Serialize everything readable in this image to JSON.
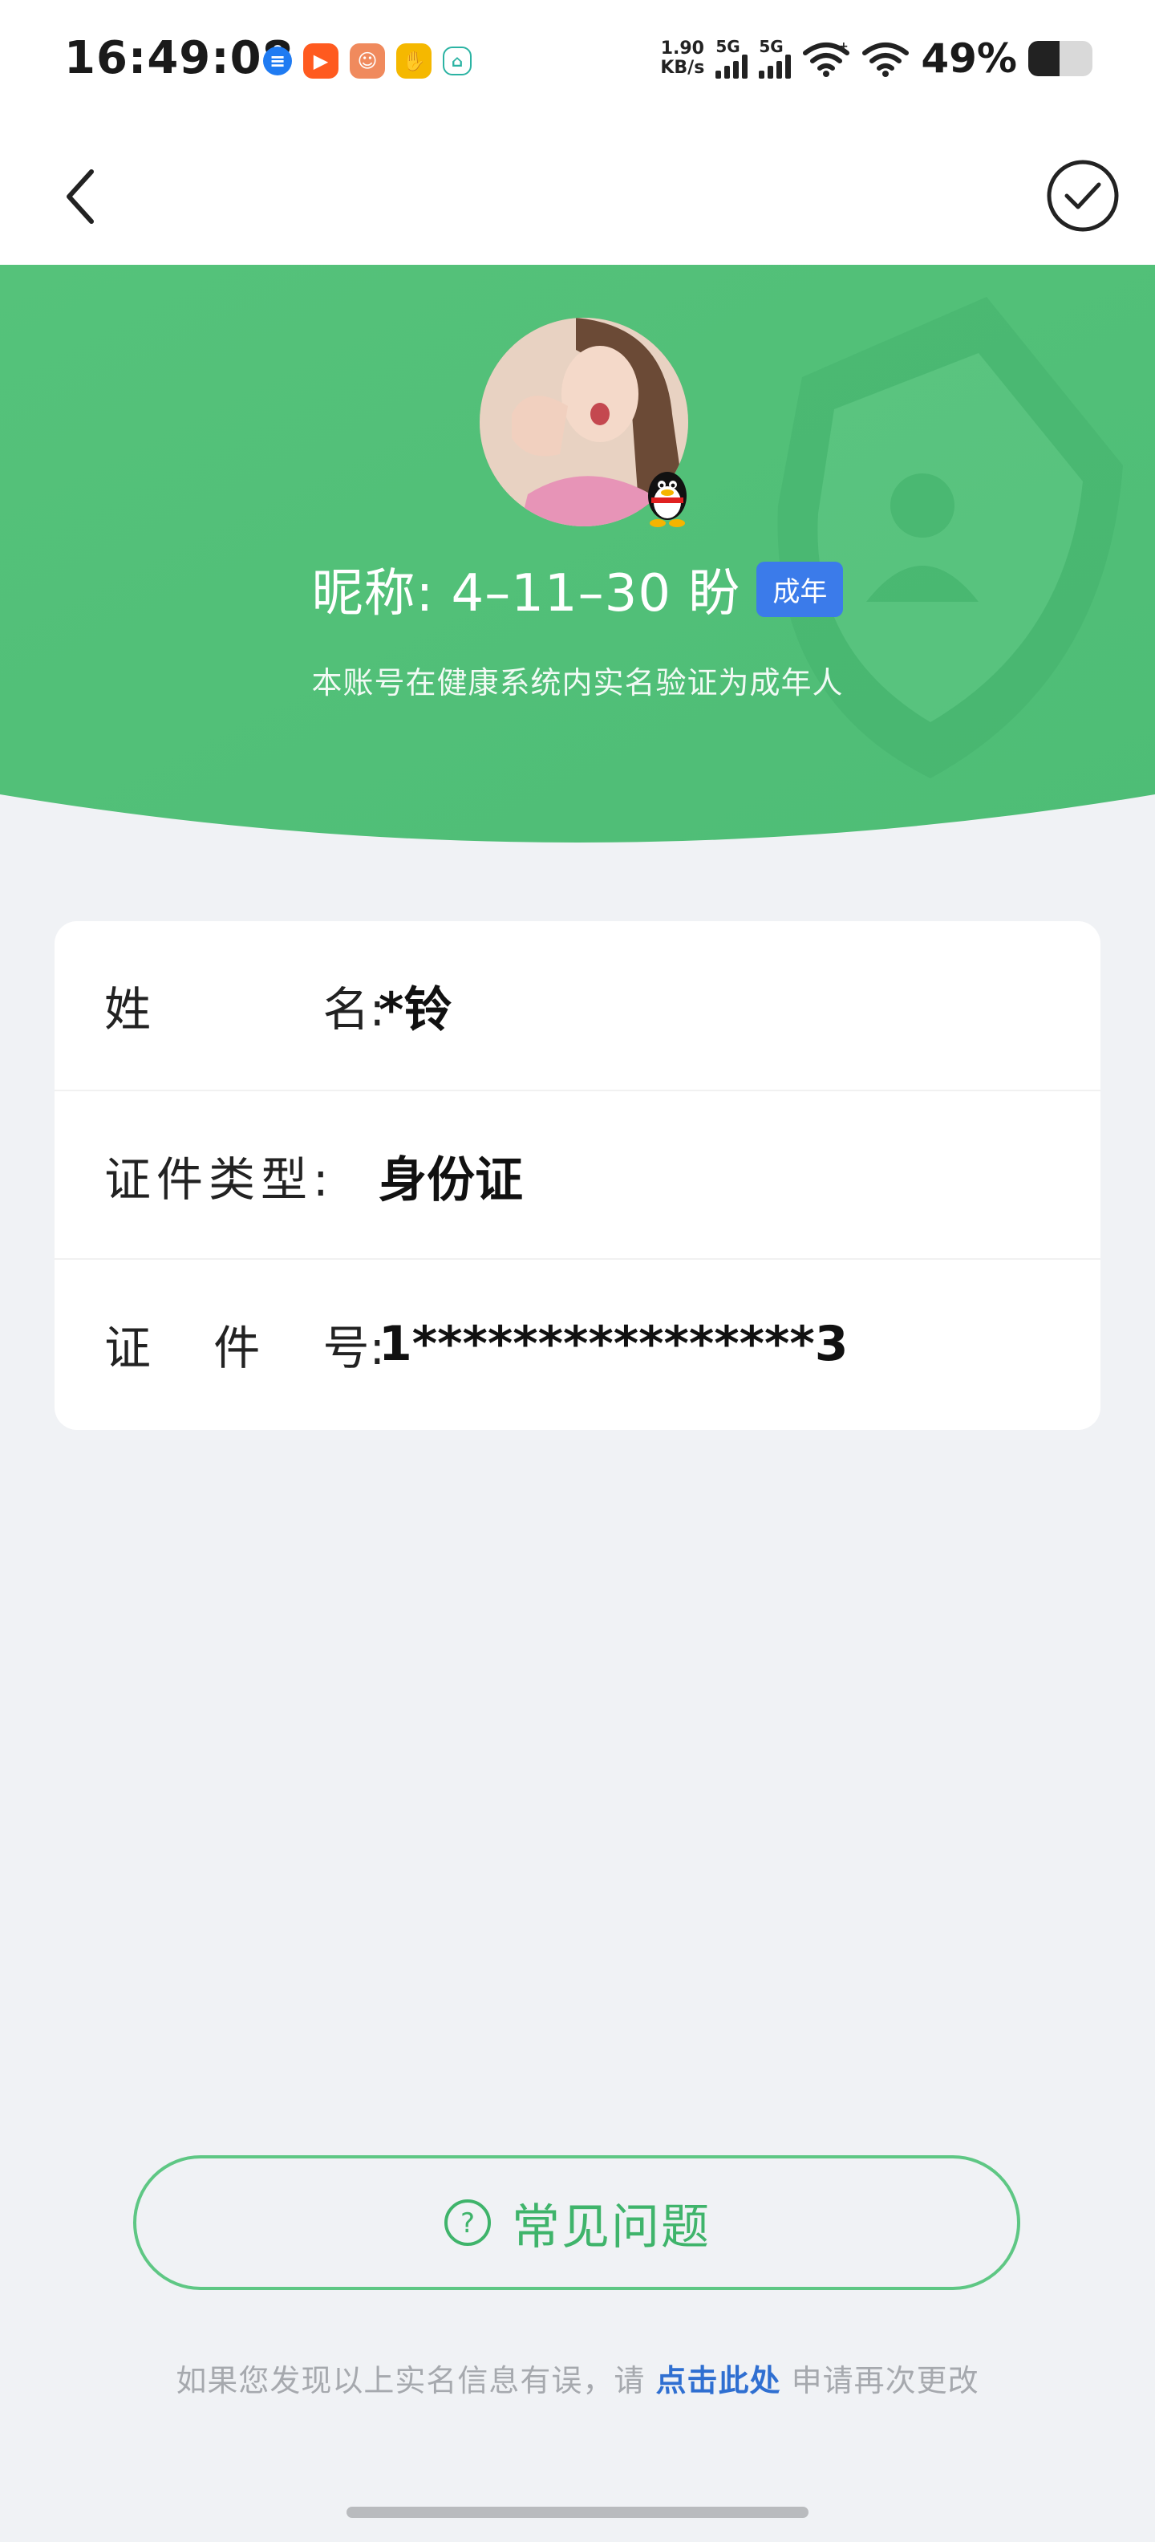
{
  "status_bar": {
    "time": "16:49:08",
    "net_speed_value": "1.90",
    "net_speed_unit": "KB/s",
    "sim1_label": "5G",
    "sim2_label": "5G",
    "battery_percent": "49%",
    "battery_level": 0.49
  },
  "nav": {
    "back_icon": "chevron-left-icon",
    "confirm_icon": "check-circle-icon"
  },
  "profile": {
    "nickname": "昵称: 4–11–30 盼",
    "age_badge": "成年",
    "verification_note": "本账号在健康系统内实名验证为成年人"
  },
  "info": {
    "rows": [
      {
        "label_chars": [
          "姓",
          "名:"
        ],
        "value": "*铃"
      },
      {
        "label_chars": [
          "证件类型:"
        ],
        "value": "身份证"
      },
      {
        "label_chars": [
          "证",
          "件",
          "号:"
        ],
        "value": "1****************3"
      }
    ]
  },
  "faq": {
    "label": "常见问题",
    "icon": "question-circle-icon"
  },
  "footer": {
    "prefix": "如果您发现以上实名信息有误，请 ",
    "link": "点击此处",
    "suffix": " 申请再次更改"
  },
  "colors": {
    "brand_green": "#4cbf73",
    "badge_blue": "#3b7bea",
    "link_blue": "#2f6fd1"
  }
}
